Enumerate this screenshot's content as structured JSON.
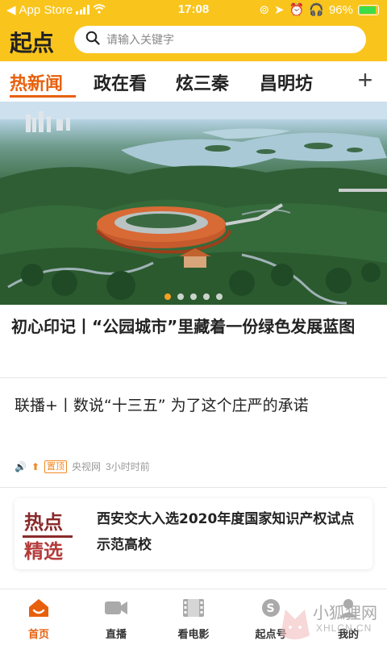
{
  "status_bar": {
    "back_app": "App Store",
    "time": "17:08",
    "battery": "96%"
  },
  "header": {
    "logo": "起点",
    "search_placeholder": "请输入关键字"
  },
  "tabs": [
    {
      "label": "热新闻",
      "active": true
    },
    {
      "label": "政在看",
      "active": false
    },
    {
      "label": "炫三秦",
      "active": false
    },
    {
      "label": "昌明坊",
      "active": false
    }
  ],
  "add_tab_label": "+",
  "banner": {
    "slides": 5,
    "current": 1,
    "headline": "初心印记丨“公园城市”里藏着一份绿色发展蓝图"
  },
  "news": [
    {
      "title": "联播+丨数说“十三五” 为了这个庄严的承诺",
      "tag": "置顶",
      "source": "央视网",
      "time": "3小时时前"
    }
  ],
  "featured_card": {
    "image_text_1": "热点",
    "image_text_2": "精选",
    "title": "西安交大入选2020年度国家知识产权试点示范高校"
  },
  "bottom_nav": [
    {
      "label": "首页",
      "icon": "home-icon",
      "active": true
    },
    {
      "label": "直播",
      "icon": "video-camera-icon",
      "active": false
    },
    {
      "label": "看电影",
      "icon": "film-icon",
      "active": false
    },
    {
      "label": "起点号",
      "icon": "origin-account-icon",
      "active": false
    },
    {
      "label": "我的",
      "icon": "profile-icon",
      "active": false
    }
  ],
  "watermark": {
    "text": "小狐狸网",
    "sub": "XHLCN.CN"
  },
  "colors": {
    "header_bg": "#f9c41c",
    "accent": "#e8600c",
    "tag": "#f08a24"
  }
}
